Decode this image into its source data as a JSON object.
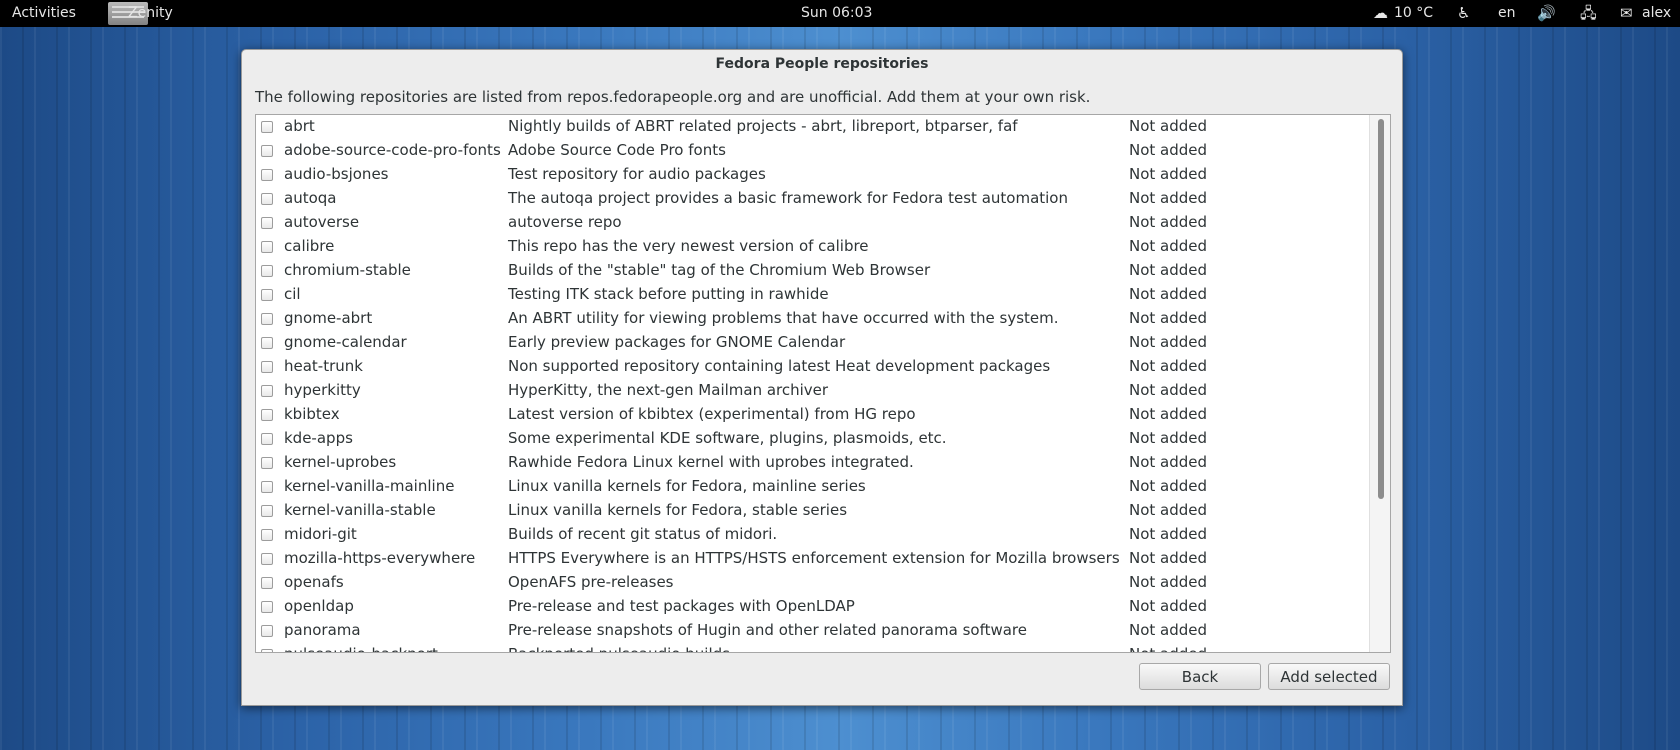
{
  "topbar": {
    "activities": "Activities",
    "app_name": "Zenity",
    "clock": "Sun 06:03",
    "weather": "10 °C",
    "language": "en",
    "user": "alex",
    "icons": [
      "weather-icon",
      "accessibility-icon",
      "volume-icon",
      "network-icon",
      "user-status-icon"
    ]
  },
  "dialog": {
    "title": "Fedora People repositories",
    "description": "The following repositories are listed from repos.fedorapeople.org and are unofficial. Add them at your own risk.",
    "rows": [
      {
        "name": "abrt",
        "desc": "Nightly builds of ABRT related projects - abrt, libreport, btparser, faf",
        "status": "Not added"
      },
      {
        "name": "adobe-source-code-pro-fonts",
        "desc": "Adobe Source Code Pro fonts",
        "status": "Not added"
      },
      {
        "name": "audio-bsjones",
        "desc": "Test repository for audio packages",
        "status": "Not added"
      },
      {
        "name": "autoqa",
        "desc": "The autoqa project provides a basic framework for Fedora test automation",
        "status": "Not added"
      },
      {
        "name": "autoverse",
        "desc": "autoverse repo",
        "status": "Not added"
      },
      {
        "name": "calibre",
        "desc": "This repo has the very newest version of calibre",
        "status": "Not added"
      },
      {
        "name": "chromium-stable",
        "desc": "Builds of the \"stable\" tag of the Chromium Web Browser",
        "status": "Not added"
      },
      {
        "name": "cil",
        "desc": "Testing ITK stack before putting in rawhide",
        "status": "Not added"
      },
      {
        "name": "gnome-abrt",
        "desc": "An ABRT utility for viewing problems that have occurred with the system.",
        "status": "Not added"
      },
      {
        "name": "gnome-calendar",
        "desc": "Early preview packages for GNOME Calendar",
        "status": "Not added"
      },
      {
        "name": "heat-trunk",
        "desc": "Non supported repository containing latest Heat development packages",
        "status": "Not added"
      },
      {
        "name": "hyperkitty",
        "desc": "HyperKitty, the next-gen Mailman archiver",
        "status": "Not added"
      },
      {
        "name": "kbibtex",
        "desc": "Latest version of kbibtex (experimental) from HG repo",
        "status": "Not added"
      },
      {
        "name": "kde-apps",
        "desc": "Some experimental KDE software, plugins, plasmoids, etc.",
        "status": "Not added"
      },
      {
        "name": "kernel-uprobes",
        "desc": "Rawhide Fedora Linux kernel with uprobes integrated.",
        "status": "Not added"
      },
      {
        "name": "kernel-vanilla-mainline",
        "desc": "Linux vanilla kernels for Fedora, mainline series",
        "status": "Not added"
      },
      {
        "name": "kernel-vanilla-stable",
        "desc": "Linux vanilla kernels for Fedora, stable series",
        "status": "Not added"
      },
      {
        "name": "midori-git",
        "desc": "Builds of recent git status of midori.",
        "status": "Not added"
      },
      {
        "name": "mozilla-https-everywhere",
        "desc": "HTTPS Everywhere is an HTTPS/HSTS enforcement extension for Mozilla browsers",
        "status": "Not added"
      },
      {
        "name": "openafs",
        "desc": "OpenAFS pre-releases",
        "status": "Not added"
      },
      {
        "name": "openldap",
        "desc": "Pre-release and test packages with OpenLDAP",
        "status": "Not added"
      },
      {
        "name": "panorama",
        "desc": "Pre-release snapshots of Hugin and other related panorama software",
        "status": "Not added"
      },
      {
        "name": "pulseaudio-backport",
        "desc": "Backported pulseaudio builds",
        "status": "Not added"
      }
    ],
    "back_label": "Back",
    "add_label": "Add selected"
  }
}
